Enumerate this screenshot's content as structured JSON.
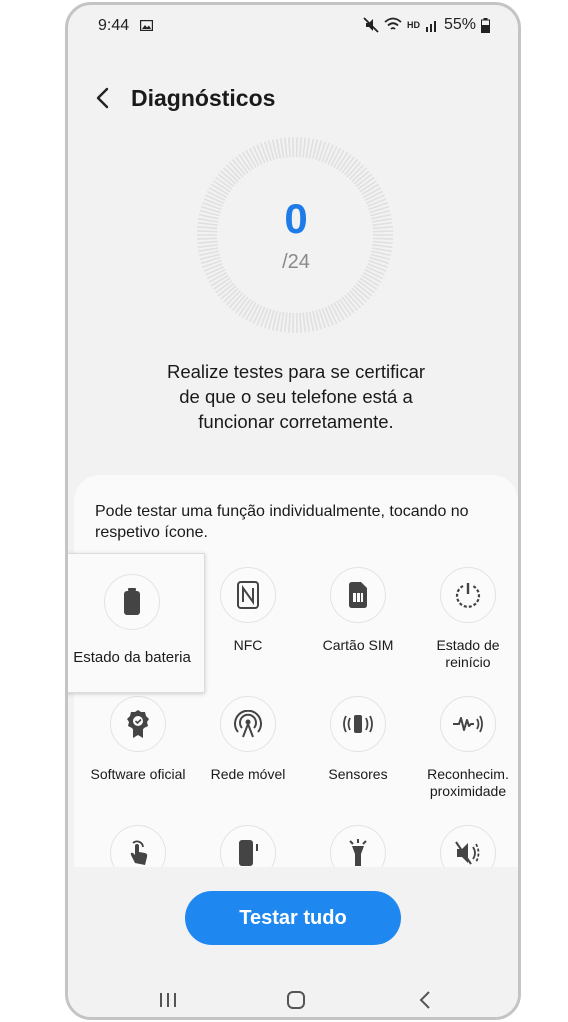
{
  "status": {
    "time": "9:44",
    "hd_label": "HD",
    "battery": "55%"
  },
  "header": {
    "title": "Diagnósticos"
  },
  "progress": {
    "count": "0",
    "total": "/24"
  },
  "description": [
    "Realize testes para se certificar",
    "de que o seu telefone está a",
    "funcionar corretamente."
  ],
  "hint": "Pode testar uma função individualmente, tocando no respetivo ícone.",
  "tests": [
    {
      "label": "Estado da bateria",
      "icon": "battery-icon"
    },
    {
      "label": "NFC",
      "icon": "nfc-icon"
    },
    {
      "label": "Cartão SIM",
      "icon": "sim-card-icon"
    },
    {
      "label": "Estado de reinício",
      "icon": "restart-icon"
    },
    {
      "label": "Software oficial",
      "icon": "certified-badge-icon"
    },
    {
      "label": "Rede móvel",
      "icon": "antenna-icon"
    },
    {
      "label": "Sensores",
      "icon": "sensor-vibrate-icon"
    },
    {
      "label": "Reconhecim. proximidade",
      "icon": "proximity-icon"
    },
    {
      "label": "",
      "icon": "touch-icon"
    },
    {
      "label": "",
      "icon": "phone-side-button-icon"
    },
    {
      "label": "",
      "icon": "flashlight-icon"
    },
    {
      "label": "",
      "icon": "speaker-mute-icon"
    }
  ],
  "actions": {
    "test_all": "Testar tudo"
  },
  "colors": {
    "accent": "#1f88f0",
    "count": "#1f7be8",
    "background": "#f2f2f2"
  }
}
